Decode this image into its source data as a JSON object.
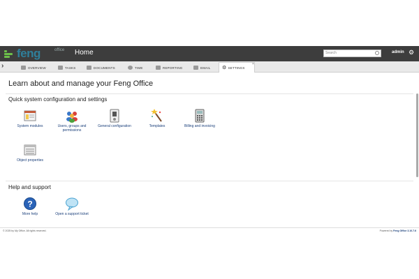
{
  "header": {
    "logo_text": "feng",
    "logo_sub": "office",
    "title": "Home",
    "search_placeholder": "Search",
    "user": "admin"
  },
  "tabs": [
    {
      "label": "OVERVIEW",
      "icon": "overview-icon"
    },
    {
      "label": "TASKS",
      "icon": "tasks-icon"
    },
    {
      "label": "DOCUMENTS",
      "icon": "folder-icon"
    },
    {
      "label": "TIME",
      "icon": "clock-icon"
    },
    {
      "label": "REPORTING",
      "icon": "chart-icon"
    },
    {
      "label": "EMAIL",
      "icon": "mail-icon"
    },
    {
      "label": "SETTINGS",
      "icon": "gear-icon",
      "active": true
    }
  ],
  "main": {
    "heading": "Learn about and manage your Feng Office",
    "section1_title": "Quick system configuration and settings",
    "config_items": [
      {
        "label": "System modules",
        "icon": "window-icon"
      },
      {
        "label": "Users, groups and permissions",
        "icon": "users-icon"
      },
      {
        "label": "General configuration",
        "icon": "config-icon"
      },
      {
        "label": "Templates",
        "icon": "wand-icon"
      },
      {
        "label": "Billing and invoicing",
        "icon": "calculator-icon"
      },
      {
        "label": "Object properties",
        "icon": "list-icon"
      }
    ],
    "section2_title": "Help and support",
    "help_items": [
      {
        "label": "More help",
        "icon": "help-icon"
      },
      {
        "label": "Open a support ticket",
        "icon": "speech-bubble-icon"
      }
    ]
  },
  "footer": {
    "copyright": "© 2025 by My Office. All rights reserved.",
    "powered_prefix": "Powered by",
    "powered_product": "Feng Office 3.10.7.6"
  },
  "colors": {
    "topbar": "#3d3d3d",
    "brand_green": "#6cc04a",
    "brand_blue": "#2f7f9a",
    "link": "#1a3f7a"
  }
}
